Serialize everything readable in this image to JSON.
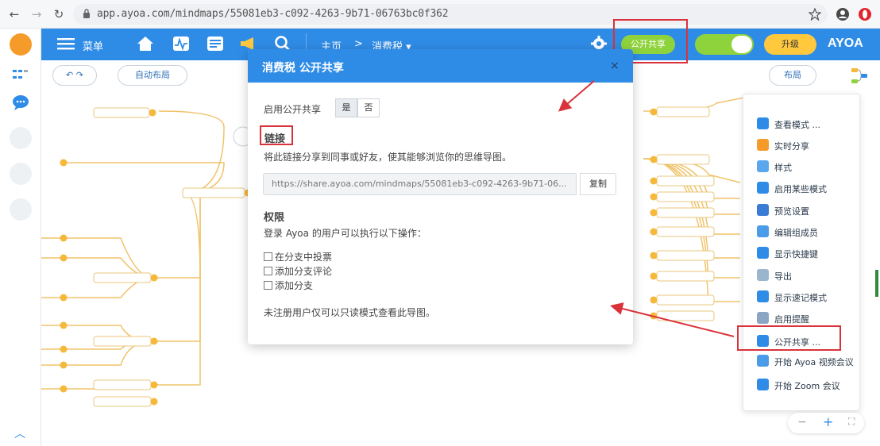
{
  "browser": {
    "url": "app.ayoa.com/mindmaps/55081eb3-c092-4263-9b71-06763bc0f362",
    "back": "←",
    "forward": "→",
    "reload": "↻"
  },
  "appbar": {
    "menu_label": "菜单",
    "breadcrumb_home": "主页",
    "breadcrumb_sep": ">",
    "breadcrumb_current": "消费税 ▾",
    "share_label": "公开共享",
    "upgrade_label": "升级",
    "brand": "AYOA"
  },
  "toolbar": {
    "auto_layout_label": "自动布局",
    "layout_right_label": "布局"
  },
  "modal": {
    "title": "消费税 公开共享",
    "close": "×",
    "enable_label": "启用公开共享",
    "toggle_on": "是",
    "toggle_off": "否",
    "link_heading": "链接",
    "link_desc": "将此链接分享到同事或好友，使其能够浏览你的思维导图。",
    "link_url": "https://share.ayoa.com/mindmaps/55081eb3-c092-4263-9b71-06...",
    "copy_label": "复制",
    "perm_heading": "权限",
    "perm_desc": "登录 Ayoa 的用户可以执行以下操作：",
    "perm_options": [
      "在分支中投票",
      "添加分支评论",
      "添加分支"
    ],
    "footer_note": "未注册用户仅可以只读模式查看此导图。"
  },
  "rightmenu": {
    "items": [
      {
        "label": "查看模式 ..."
      },
      {
        "label": "实时分享"
      },
      {
        "label": "样式"
      },
      {
        "label": "启用某些模式"
      },
      {
        "label": "预览设置"
      },
      {
        "label": "编辑组成员"
      },
      {
        "label": "显示快捷键"
      },
      {
        "label": "导出"
      },
      {
        "label": "显示速记模式"
      },
      {
        "label": "启用提醒"
      },
      {
        "label": "公开共享 ..."
      },
      {
        "label": "开始 Ayoa 视频会议"
      },
      {
        "label": "开始 Zoom 会议"
      }
    ]
  },
  "colors": {
    "primary": "#2f8ce6",
    "share_green": "#8fd33c",
    "upgrade_yellow": "#ffc83d",
    "annotation_red": "#d9323a",
    "node_orange": "#f5b83b"
  }
}
